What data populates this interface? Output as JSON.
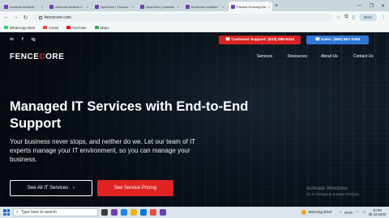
{
  "browser": {
    "tabs": [
      {
        "label": "zeetcum infotech",
        "icon": "p-favicon"
      },
      {
        "label": "zeetcum infotech o",
        "icon": "p-favicon"
      },
      {
        "label": "OpenText | Fencew",
        "icon": "p-favicon"
      },
      {
        "label": "OpenText | Infomati",
        "icon": "p-favicon"
      },
      {
        "label": "fencecore solution",
        "icon": "p-favicon"
      },
      {
        "label": "Fastest Growing Ma",
        "icon": "p-favicon",
        "active": true
      }
    ],
    "url": "fencecore.com",
    "profile_label": "Error",
    "bookmarks": [
      {
        "label": "WhatsApp Web",
        "icon": "whatsapp-icon"
      },
      {
        "label": "Gmail",
        "icon": "gmail-icon"
      },
      {
        "label": "YouTube",
        "icon": "youtube-icon"
      },
      {
        "label": "Maps",
        "icon": "maps-icon"
      }
    ]
  },
  "site": {
    "social": [
      "in",
      "f",
      "ig"
    ],
    "support_button": "☎ Customer Support: (833) 288-6414",
    "sales_button": "☎ Sales: (855) 667-0355",
    "logo_main": "FENCE",
    "logo_accent": "C",
    "logo_rest": "ORE",
    "nav": [
      "Services",
      "Resources",
      "About Us",
      "Contact Us"
    ],
    "headline": "Managed IT Services with End-to-End Support",
    "subtext": "Your business never stops, and neither do we. Let our team of IT experts manage your IT environment, so you can manage your business.",
    "btn_all_services": "See All IT Services",
    "btn_pricing": "See Service Pricing",
    "watermark_title": "Activate Windows",
    "watermark_sub": "Go to Settings to activate Windows."
  },
  "taskbar": {
    "search_placeholder": "Type here to search",
    "weather": "Morning Brief",
    "lang": "ENG",
    "time": "10:09",
    "date": "25-12-2023"
  },
  "colors": {
    "brand_red": "#e02424",
    "brand_blue": "#2f78d7"
  }
}
